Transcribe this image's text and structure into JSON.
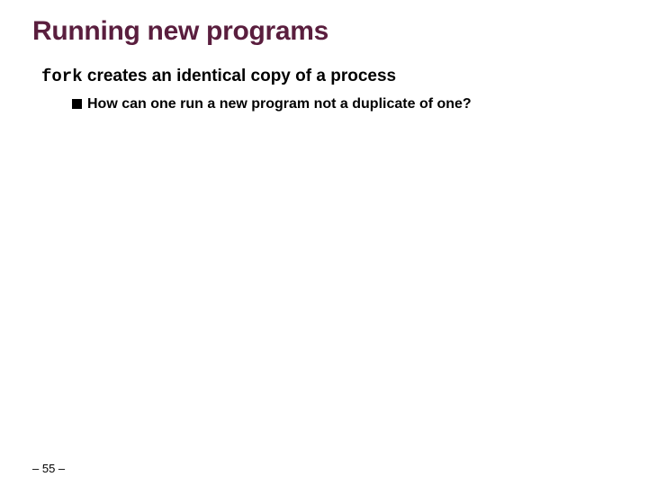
{
  "title": "Running new programs",
  "line1_code": "fork",
  "line1_rest": " creates an identical copy of a process",
  "bullet": "How can one run a new program not a duplicate of one?",
  "page_prefix": "– ",
  "page_number": "55",
  "page_suffix": " –"
}
